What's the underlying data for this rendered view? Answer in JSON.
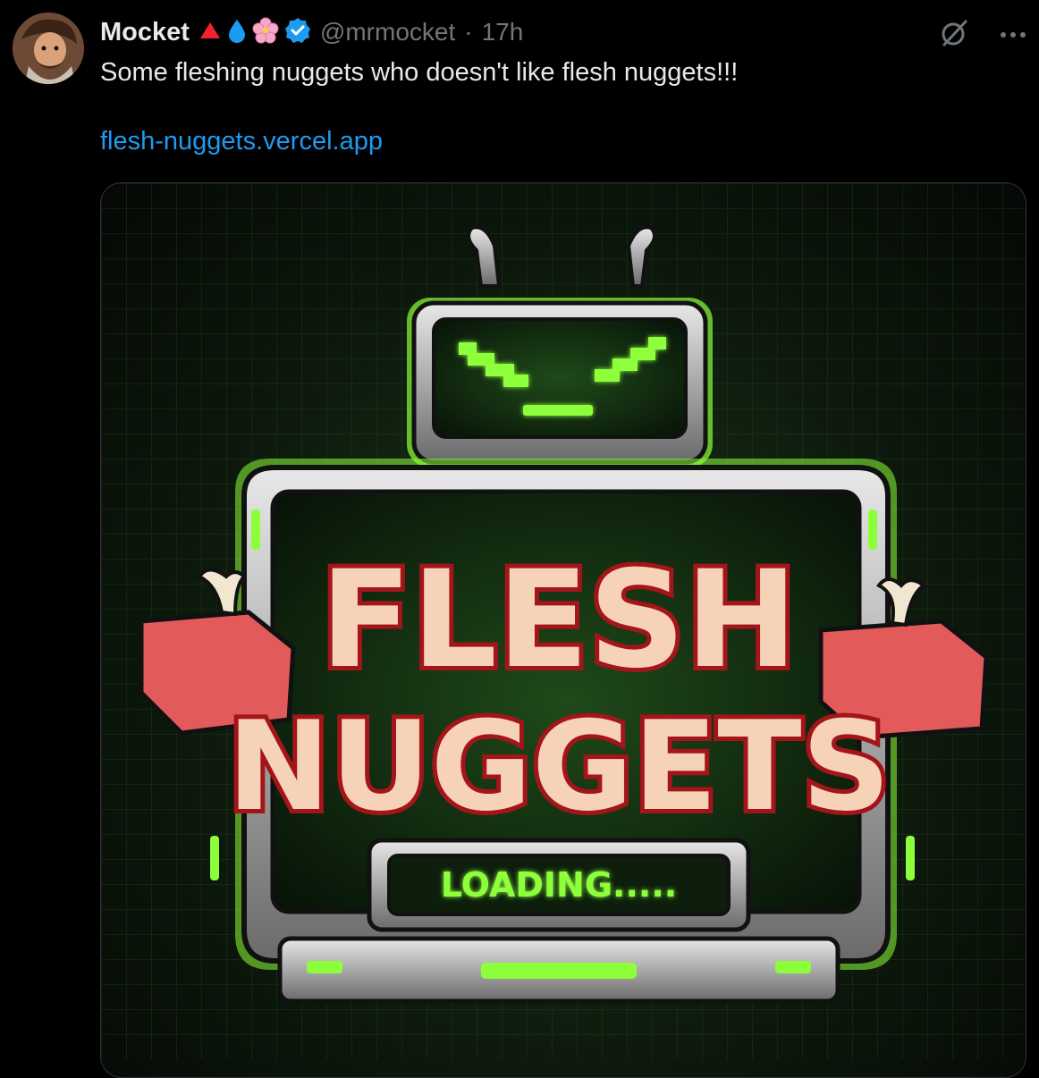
{
  "tweet": {
    "author_name": "Mocket",
    "badges": [
      "red-triangle-icon",
      "water-drop-icon",
      "cherry-blossom-icon",
      "verified-badge-icon"
    ],
    "handle": "@mrmocket",
    "separator": "·",
    "time": "17h",
    "text": "Some fleshing nuggets who doesn't like flesh nuggets!!!",
    "link": "flesh-nuggets.vercel.app",
    "actions": [
      "grok-icon",
      "more-options-icon"
    ]
  },
  "media": {
    "title_line1": "FLESH",
    "title_line2": "NUGGETS",
    "loading_text": "LOADING.....",
    "colors": {
      "accent_green": "#8dff3a",
      "flesh": "#f6d3b8",
      "outline_red": "#a3151a",
      "link_blue": "#1d9bf0"
    }
  }
}
